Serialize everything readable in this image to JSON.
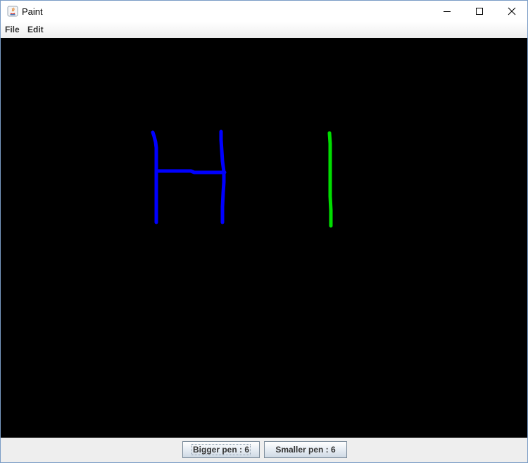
{
  "window": {
    "title": "Paint"
  },
  "menu": {
    "items": [
      "File",
      "Edit"
    ]
  },
  "buttons": {
    "bigger": "Bigger pen : 6",
    "smaller": "Smaller pen : 6"
  },
  "colors": {
    "canvas_bg": "#000000",
    "stroke_blue": "#0000ff",
    "stroke_green": "#00dd00"
  }
}
